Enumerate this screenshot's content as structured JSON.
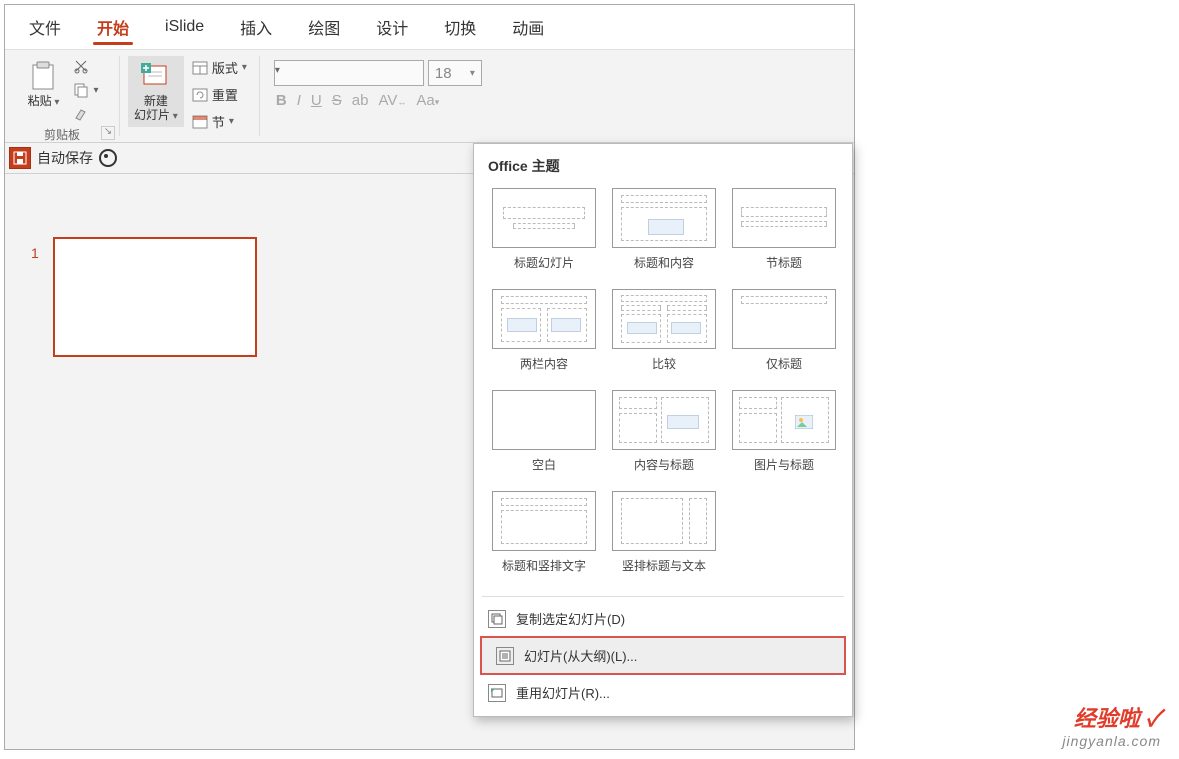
{
  "tabs": {
    "file": "文件",
    "home": "开始",
    "islide": "iSlide",
    "insert": "插入",
    "draw": "绘图",
    "design": "设计",
    "transition": "切换",
    "animation": "动画"
  },
  "ribbon": {
    "clipboard": {
      "paste": "粘贴",
      "group": "剪贴板"
    },
    "slides": {
      "newslide": "新建\n幻灯片",
      "layoutBtn": "版式",
      "reset": "重置",
      "section": "节"
    },
    "font": {
      "size": "18",
      "bold": "B",
      "italic": "I",
      "underline": "U",
      "strike": "S",
      "ab": "ab",
      "av": "AV",
      "aa": "Aa"
    }
  },
  "quickbar": {
    "autosave": "自动保存"
  },
  "slide": {
    "number": "1"
  },
  "dropdown": {
    "title": "Office 主题",
    "layouts": [
      "标题幻灯片",
      "标题和内容",
      "节标题",
      "两栏内容",
      "比较",
      "仅标题",
      "空白",
      "内容与标题",
      "图片与标题",
      "标题和竖排文字",
      "竖排标题与文本"
    ],
    "menu": {
      "duplicate": "复制选定幻灯片(D)",
      "outline": "幻灯片(从大纲)(L)...",
      "reuse": "重用幻灯片(R)..."
    }
  },
  "watermark": {
    "line1": "经验啦",
    "line2": "jingyanla.com"
  }
}
